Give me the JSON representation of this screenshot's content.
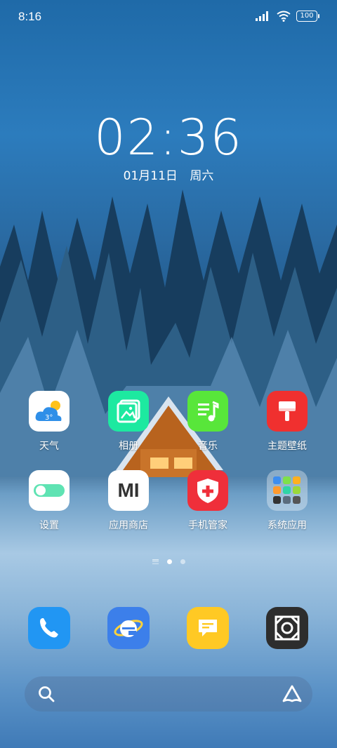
{
  "status": {
    "time": "8:16",
    "battery": "100"
  },
  "clock": {
    "time": "02:36",
    "date": "01月11日",
    "weekday": "周六"
  },
  "apps": [
    {
      "label": "天气",
      "icon": "weather-icon",
      "temp": "3°"
    },
    {
      "label": "相册",
      "icon": "gallery-icon"
    },
    {
      "label": "音乐",
      "icon": "music-icon"
    },
    {
      "label": "主题壁纸",
      "icon": "theme-icon"
    },
    {
      "label": "设置",
      "icon": "settings-toggle-icon"
    },
    {
      "label": "应用商店",
      "icon": "mi-store-icon",
      "icon_text": "MI"
    },
    {
      "label": "手机管家",
      "icon": "security-shield-icon"
    },
    {
      "label": "系统应用",
      "icon": "folder-icon"
    }
  ],
  "dock": [
    {
      "icon": "phone-icon"
    },
    {
      "icon": "browser-icon"
    },
    {
      "icon": "messages-icon"
    },
    {
      "icon": "camera-icon"
    }
  ],
  "colors": {
    "weather": "#ffffff",
    "gallery": "#1de9a0",
    "music": "#58e63a",
    "theme": "#f0302f",
    "settings": "#ffffff",
    "store": "#ffffff",
    "security": "#ef2f3a",
    "phone": "#2196f3",
    "browser": "#3c7fea",
    "messages": "#ffc924",
    "camera": "#2d2d2d"
  }
}
